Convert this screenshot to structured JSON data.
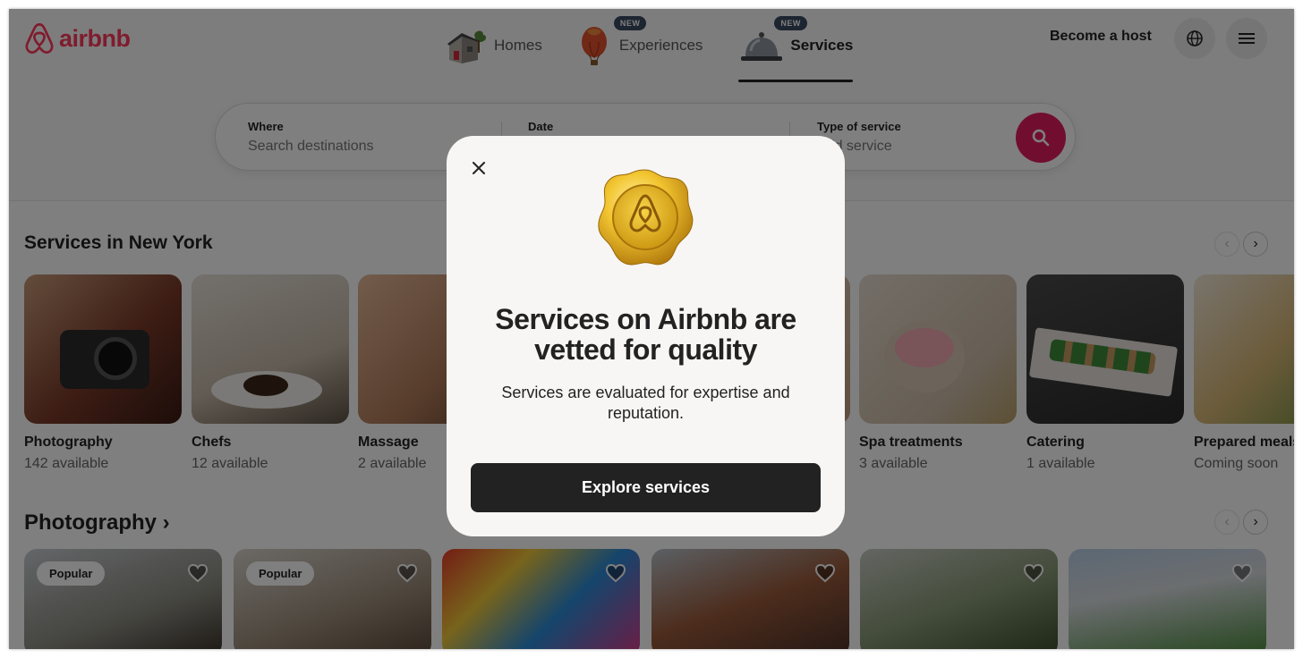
{
  "brand": {
    "name": "airbnb",
    "color": "#ff385c"
  },
  "nav": {
    "tabs": [
      {
        "label": "Homes",
        "icon": "house-icon",
        "badge": ""
      },
      {
        "label": "Experiences",
        "icon": "hot-air-balloon-icon",
        "badge": "NEW"
      },
      {
        "label": "Services",
        "icon": "service-bell-icon",
        "badge": "NEW",
        "active": true
      }
    ],
    "become_host": "Become a host",
    "globe_icon": "globe-icon",
    "menu_icon": "hamburger-menu-icon"
  },
  "search": {
    "where_label": "Where",
    "where_placeholder": "Search destinations",
    "date_label": "Date",
    "type_label": "Type of service",
    "type_placeholder": "Add service",
    "search_icon": "search-icon",
    "button_color": "#e31c5f"
  },
  "services_section": {
    "title": "Services in New York",
    "cards": [
      {
        "name": "Photography",
        "sub": "142 available"
      },
      {
        "name": "Chefs",
        "sub": "12 available"
      },
      {
        "name": "Massage",
        "sub": "2 available"
      },
      {
        "name": "Spa treatments",
        "sub": "3 available"
      },
      {
        "name": "Catering",
        "sub": "1 available"
      },
      {
        "name": "Prepared meals",
        "sub": "Coming soon"
      }
    ]
  },
  "photography_section": {
    "title": "Photography ›",
    "cards": [
      {
        "badge": "Popular"
      },
      {
        "badge": "Popular"
      },
      {
        "badge": ""
      },
      {
        "badge": ""
      },
      {
        "badge": ""
      },
      {
        "badge": ""
      }
    ]
  },
  "modal": {
    "close_icon": "close-icon",
    "seal_icon": "airbnb-wax-seal-icon",
    "title": "Services on Airbnb are vetted for quality",
    "text": "Services are evaluated for expertise and reputation.",
    "button": "Explore services"
  }
}
